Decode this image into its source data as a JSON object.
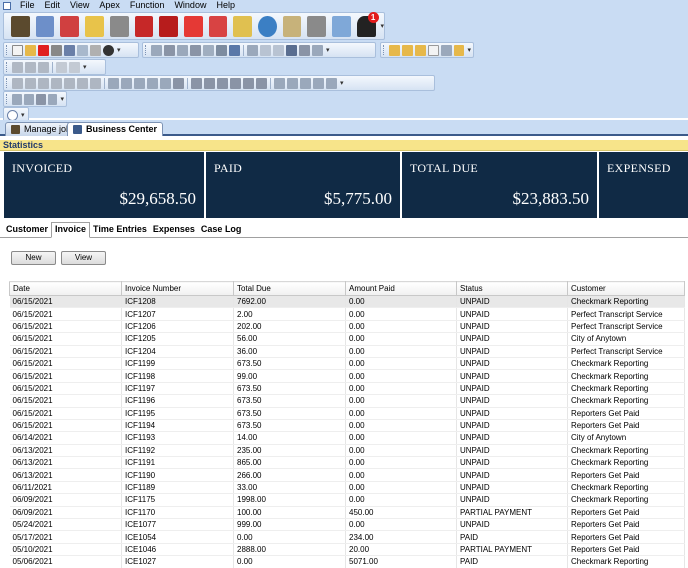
{
  "menu": [
    "File",
    "Edit",
    "View",
    "Apex",
    "Function",
    "Window",
    "Help"
  ],
  "notification_count": "1",
  "document_tabs": [
    {
      "label": "Manage jobs"
    },
    {
      "label": "Business Center"
    }
  ],
  "statistics": {
    "header": "Statistics",
    "cards": [
      {
        "title": "INVOICED",
        "value": "$29,658.50"
      },
      {
        "title": "PAID",
        "value": "$5,775.00"
      },
      {
        "title": "TOTAL DUE",
        "value": "$23,883.50"
      },
      {
        "title": "EXPENSED",
        "value": ""
      }
    ]
  },
  "subtabs": [
    {
      "label": "Customer"
    },
    {
      "label": "Invoice"
    },
    {
      "label": "Time Entries"
    },
    {
      "label": "Expenses"
    },
    {
      "label": "Case Log"
    }
  ],
  "buttons": {
    "new": "New",
    "view": "View"
  },
  "table": {
    "columns": [
      "Date",
      "Invoice Number",
      "Total Due",
      "Amount Paid",
      "Status",
      "Customer"
    ],
    "rows": [
      [
        "06/15/2021",
        "ICF1208",
        "7692.00",
        "0.00",
        "UNPAID",
        "Checkmark Reporting"
      ],
      [
        "06/15/2021",
        "ICF1207",
        "2.00",
        "0.00",
        "UNPAID",
        "Perfect Transcript Service"
      ],
      [
        "06/15/2021",
        "ICF1206",
        "202.00",
        "0.00",
        "UNPAID",
        "Perfect Transcript Service"
      ],
      [
        "06/15/2021",
        "ICF1205",
        "56.00",
        "0.00",
        "UNPAID",
        "City of Anytown"
      ],
      [
        "06/15/2021",
        "ICF1204",
        "36.00",
        "0.00",
        "UNPAID",
        "Perfect Transcript Service"
      ],
      [
        "06/15/2021",
        "ICF1199",
        "673.50",
        "0.00",
        "UNPAID",
        "Checkmark Reporting"
      ],
      [
        "06/15/2021",
        "ICF1198",
        "99.00",
        "0.00",
        "UNPAID",
        "Checkmark Reporting"
      ],
      [
        "06/15/2021",
        "ICF1197",
        "673.50",
        "0.00",
        "UNPAID",
        "Checkmark Reporting"
      ],
      [
        "06/15/2021",
        "ICF1196",
        "673.50",
        "0.00",
        "UNPAID",
        "Checkmark Reporting"
      ],
      [
        "06/15/2021",
        "ICF1195",
        "673.50",
        "0.00",
        "UNPAID",
        "Reporters Get Paid"
      ],
      [
        "06/15/2021",
        "ICF1194",
        "673.50",
        "0.00",
        "UNPAID",
        "Reporters Get Paid"
      ],
      [
        "06/14/2021",
        "ICF1193",
        "14.00",
        "0.00",
        "UNPAID",
        "City of Anytown"
      ],
      [
        "06/13/2021",
        "ICF1192",
        "235.00",
        "0.00",
        "UNPAID",
        "Checkmark Reporting"
      ],
      [
        "06/13/2021",
        "ICF1191",
        "865.00",
        "0.00",
        "UNPAID",
        "Checkmark Reporting"
      ],
      [
        "06/13/2021",
        "ICF1190",
        "266.00",
        "0.00",
        "UNPAID",
        "Reporters Get Paid"
      ],
      [
        "06/11/2021",
        "ICF1189",
        "33.00",
        "0.00",
        "UNPAID",
        "Checkmark Reporting"
      ],
      [
        "06/09/2021",
        "ICF1175",
        "1998.00",
        "0.00",
        "UNPAID",
        "Checkmark Reporting"
      ],
      [
        "06/09/2021",
        "ICF1170",
        "100.00",
        "450.00",
        "PARTIAL PAYMENT",
        "Reporters Get Paid"
      ],
      [
        "05/24/2021",
        "ICE1077",
        "999.00",
        "0.00",
        "UNPAID",
        "Reporters Get Paid"
      ],
      [
        "05/17/2021",
        "ICE1054",
        "0.00",
        "234.00",
        "PAID",
        "Reporters Get Paid"
      ],
      [
        "05/10/2021",
        "ICE1046",
        "2888.00",
        "20.00",
        "PARTIAL PAYMENT",
        "Reporters Get Paid"
      ],
      [
        "05/06/2021",
        "ICE1027",
        "0.00",
        "5071.00",
        "PAID",
        "Checkmark Reporting"
      ]
    ]
  },
  "colors": {
    "card_bg": "#102a45",
    "stats_header_bg": "#f7e48a",
    "chrome_bg": "#c9dcf3"
  }
}
